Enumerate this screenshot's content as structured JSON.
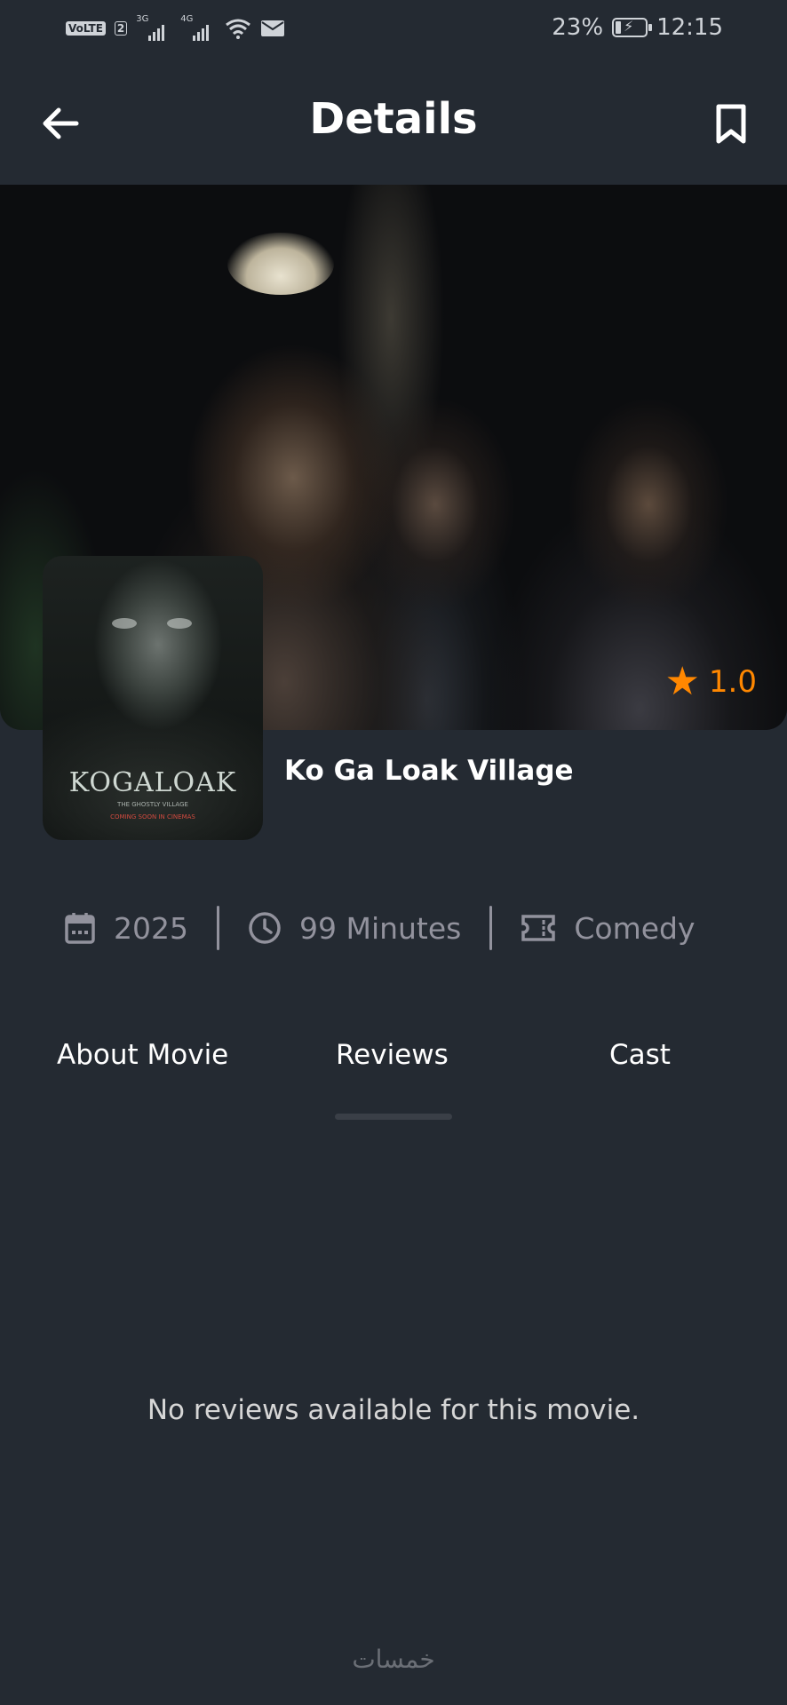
{
  "status_bar": {
    "volte": "VoLTE",
    "sim_slot": "2",
    "network_1": "3G",
    "network_2": "4G",
    "battery": "23%",
    "time": "12:15"
  },
  "header": {
    "title": "Details",
    "back_icon": "arrow-left-icon",
    "bookmark_icon": "bookmark-icon"
  },
  "movie": {
    "title": "Ko Ga Loak Village",
    "rating": "1.0",
    "year": "2025",
    "duration": "99 Minutes",
    "genre": "Comedy",
    "poster_logo": "KOGALOAK",
    "poster_subtitle": "THE GHOSTLY VILLAGE",
    "poster_tagline": "COMING SOON IN CINEMAS"
  },
  "tabs": [
    {
      "label": "About Movie",
      "active": false
    },
    {
      "label": "Reviews",
      "active": true
    },
    {
      "label": "Cast",
      "active": false
    }
  ],
  "reviews": {
    "empty_message": "No reviews available for this movie."
  },
  "watermark": "خمسات",
  "colors": {
    "background": "#242a32",
    "accent": "#ff8700",
    "muted": "#92929d",
    "text": "#ffffff"
  }
}
